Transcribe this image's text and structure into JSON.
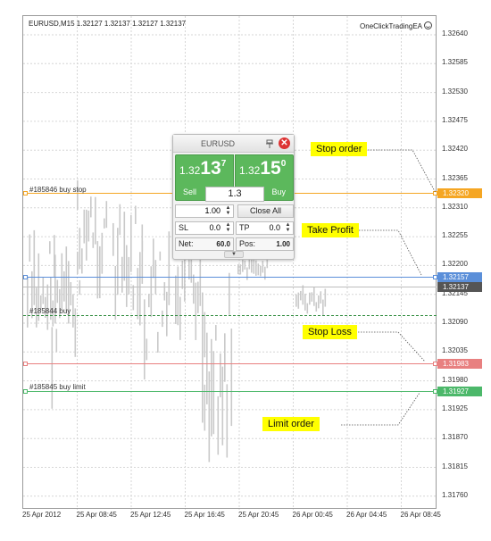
{
  "chart": {
    "symbol_info": "EURUSD,M15  1.32127 1.32137 1.32127 1.32137",
    "ea_name": "OneClickTradingEA",
    "price_axis": [
      "1.32640",
      "1.32585",
      "1.32530",
      "1.32475",
      "1.32420",
      "1.32365",
      "1.32310",
      "1.32255",
      "1.32200",
      "1.32145",
      "1.32090",
      "1.32035",
      "1.31980",
      "1.31925",
      "1.31870",
      "1.31815",
      "1.31760"
    ],
    "time_axis": [
      "25 Apr 2012",
      "25 Apr 08:45",
      "25 Apr 12:45",
      "25 Apr 16:45",
      "25 Apr 20:45",
      "26 Apr 00:45",
      "26 Apr 04:45",
      "26 Apr 08:45"
    ]
  },
  "lines": {
    "buy_stop_caption": "#185846 buy stop",
    "buy_stop_price": "1.32320",
    "take_profit_price": "1.32157",
    "current_price": "1.32137",
    "mid_caption": "#185844 buy",
    "stop_loss_price": "1.31983",
    "buy_limit_caption": "#185845 buy limit",
    "buy_limit_price": "1.31927",
    "colors": {
      "buy_stop": "#f5a623",
      "take_profit": "#5b8fd9",
      "stop_loss": "#e88080",
      "limit": "#4cb86a",
      "current": "#555555"
    }
  },
  "callouts": {
    "stop_order": "Stop order",
    "take_profit": "Take Profit",
    "stop_loss": "Stop Loss",
    "limit_order": "Limit order"
  },
  "panel": {
    "symbol": "EURUSD",
    "sell": {
      "prefix": "1.32",
      "big": "13",
      "sup": "7",
      "label": "Sell"
    },
    "buy": {
      "prefix": "1.32",
      "big": "15",
      "sup": "0",
      "label": "Buy"
    },
    "spread": "1.3",
    "lot": "1.00",
    "close_all": "Close All",
    "sl_label": "SL",
    "sl_value": "0.0",
    "tp_label": "TP",
    "tp_value": "0.0",
    "net_label": "Net:",
    "net_value": "60.0",
    "pos_label": "Pos:",
    "pos_value": "1.00",
    "accent": "#5cb85c",
    "close_icon_color": "#dd3333"
  }
}
